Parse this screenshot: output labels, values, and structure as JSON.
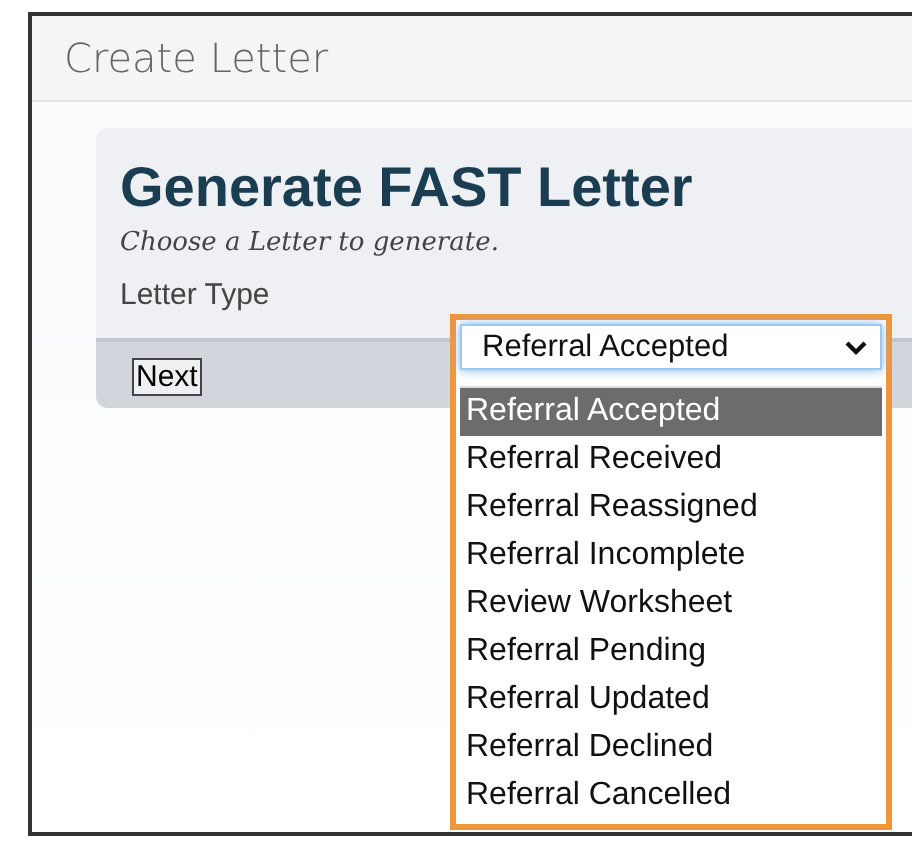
{
  "window": {
    "title": "Create Letter"
  },
  "form": {
    "heading": "Generate FAST Letter",
    "subtitle": "Choose a Letter to generate.",
    "field_label": "Letter Type",
    "select_value": "Referral Accepted",
    "expanded": true,
    "options": [
      {
        "label": "Referral Accepted",
        "selected": true
      },
      {
        "label": "Referral Received",
        "selected": false
      },
      {
        "label": "Referral Reassigned",
        "selected": false
      },
      {
        "label": "Referral Incomplete",
        "selected": false
      },
      {
        "label": "Review Worksheet",
        "selected": false
      },
      {
        "label": "Referral Pending",
        "selected": false
      },
      {
        "label": "Referral Updated",
        "selected": false
      },
      {
        "label": "Referral Declined",
        "selected": false
      },
      {
        "label": "Referral Cancelled",
        "selected": false
      }
    ]
  },
  "buttons": [
    {
      "label": "Next"
    }
  ]
}
